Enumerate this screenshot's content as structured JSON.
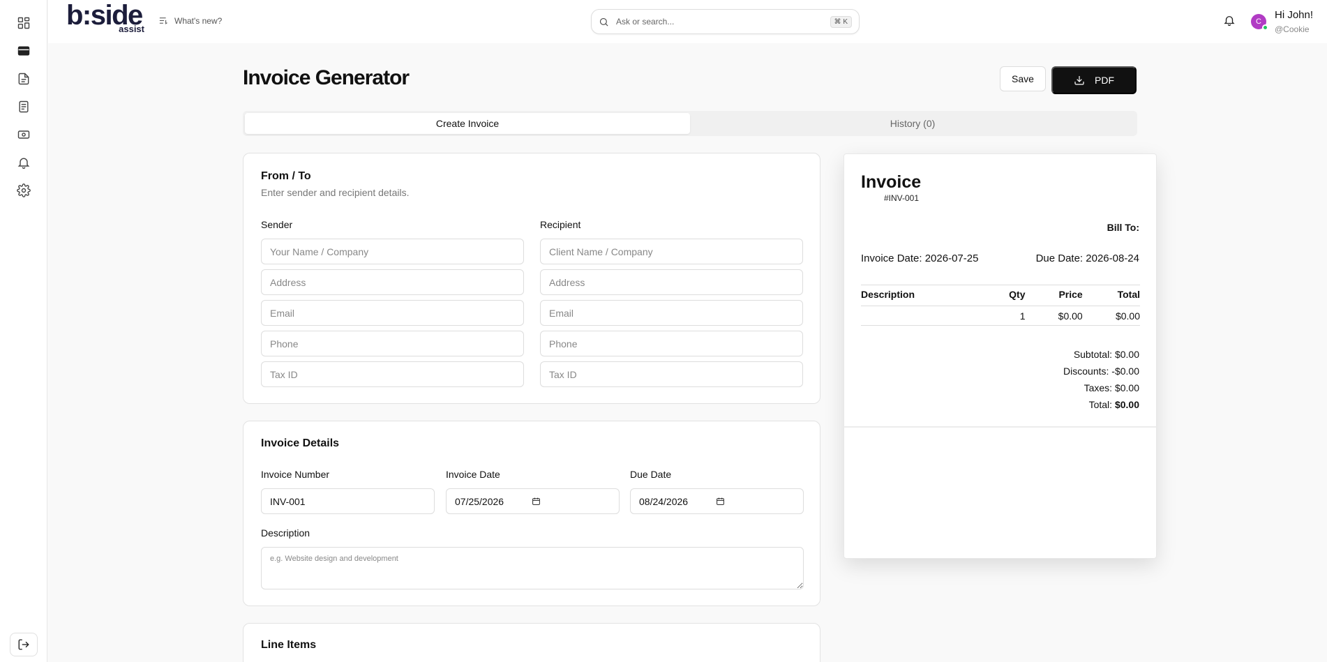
{
  "sidebar": {
    "icons": [
      "dashboard-icon",
      "card-icon",
      "document-icon",
      "notes-icon",
      "money-icon",
      "bell-icon",
      "gear-icon"
    ],
    "logout_icon": "logout-icon"
  },
  "topbar": {
    "logo_main": "b:side",
    "logo_sub": "assist",
    "whats_new": "What's new?",
    "search_placeholder": "Ask or search...",
    "search_shortcut": "⌘ K",
    "avatar_initial": "C",
    "greeting": "Hi John!",
    "handle": "@Cookie"
  },
  "header": {
    "title": "Invoice Generator",
    "save_label": "Save",
    "pdf_label": "PDF"
  },
  "tabs": [
    {
      "label": "Create Invoice",
      "active": true
    },
    {
      "label": "History (0)",
      "active": false
    }
  ],
  "from_to": {
    "title": "From / To",
    "subtitle": "Enter sender and recipient details.",
    "sender": {
      "label": "Sender",
      "name_placeholder": "Your Name / Company",
      "address_placeholder": "Address",
      "email_placeholder": "Email",
      "phone_placeholder": "Phone",
      "tax_placeholder": "Tax ID"
    },
    "recipient": {
      "label": "Recipient",
      "name_placeholder": "Client Name / Company",
      "address_placeholder": "Address",
      "email_placeholder": "Email",
      "phone_placeholder": "Phone",
      "tax_placeholder": "Tax ID"
    }
  },
  "details": {
    "title": "Invoice Details",
    "number_label": "Invoice Number",
    "number_value": "INV-001",
    "invoice_date_label": "Invoice Date",
    "invoice_date_value": "07/25/2026",
    "due_date_label": "Due Date",
    "due_date_value": "08/24/2026",
    "description_label": "Description",
    "description_placeholder": "e.g. Website design and development"
  },
  "line_items": {
    "title": "Line Items"
  },
  "preview": {
    "title": "Invoice",
    "number": "#INV-001",
    "bill_to": "Bill To:",
    "invoice_date": "Invoice Date: 2026-07-25",
    "due_date": "Due Date: 2026-08-24",
    "columns": [
      "Description",
      "Qty",
      "Price",
      "Total"
    ],
    "rows": [
      [
        "",
        "1",
        "$0.00",
        "$0.00"
      ]
    ],
    "subtotal": "Subtotal: $0.00",
    "discounts": "Discounts: -$0.00",
    "taxes": "Taxes: $0.00",
    "total_label": "Total:",
    "total_value": "$0.00"
  }
}
